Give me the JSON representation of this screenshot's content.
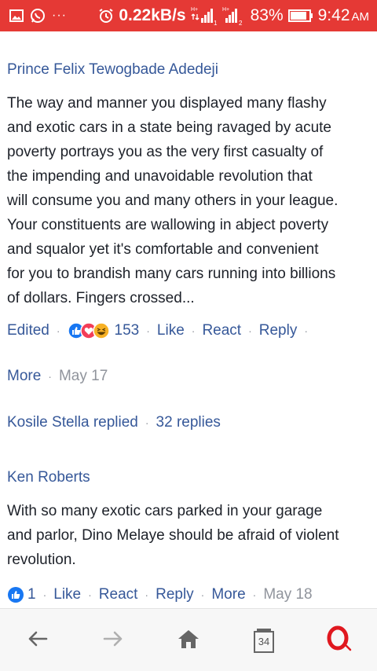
{
  "status_bar": {
    "speed": "0.22kB/s",
    "battery": "83%",
    "time": "9:42",
    "ampm": "AM",
    "more_dots": "···",
    "sim1": "1",
    "sim2": "2",
    "h_plus": "H+",
    "h_plus_2": "H+",
    "colors": {
      "background": "#e53935",
      "foreground": "#ffffff"
    }
  },
  "comments": [
    {
      "author": "Prince Felix Tewogbade Adedeji",
      "lines": [
        "The way and manner you displayed many flashy",
        "and exotic cars in a state being ravaged by acute",
        "poverty portrays you as the very first casualty of",
        "the impending and unavoidable revolution that",
        "will consume you and many others in your league.",
        "Your constituents are wallowing in abject poverty",
        "and squalor yet it's comfortable and convenient",
        "for you to brandish many cars running into billions",
        "of dollars. Fingers crossed..."
      ],
      "edited_label": "Edited",
      "reaction_count": "153",
      "like_label": "Like",
      "react_label": "React",
      "reply_label": "Reply",
      "more_label": "More",
      "date": "May 17",
      "reactions": [
        "like-icon",
        "love-icon",
        "haha-icon"
      ],
      "replies": {
        "replier_text": "Kosile Stella replied",
        "count_text": "32 replies"
      }
    },
    {
      "author": "Ken Roberts",
      "lines": [
        "With so many exotic cars parked in your garage",
        "and parlor, Dino Melaye should be afraid of violent",
        "revolution."
      ],
      "reaction_count": "1",
      "like_label": "Like",
      "react_label": "React",
      "reply_label": "Reply",
      "more_label": "More",
      "date": "May 18",
      "reactions": [
        "like-icon"
      ]
    }
  ],
  "bottom_nav": {
    "tabs_count": "34",
    "items": [
      "back-icon",
      "forward-icon",
      "home-icon",
      "tabs-icon",
      "opera-icon"
    ]
  },
  "colors": {
    "link": "#365899",
    "text": "#1d2129",
    "muted": "#90949c",
    "like_blue": "#1877f2",
    "love_red": "#f33e58",
    "haha_yellow": "#f7b125",
    "opera_red": "#e0181f"
  }
}
